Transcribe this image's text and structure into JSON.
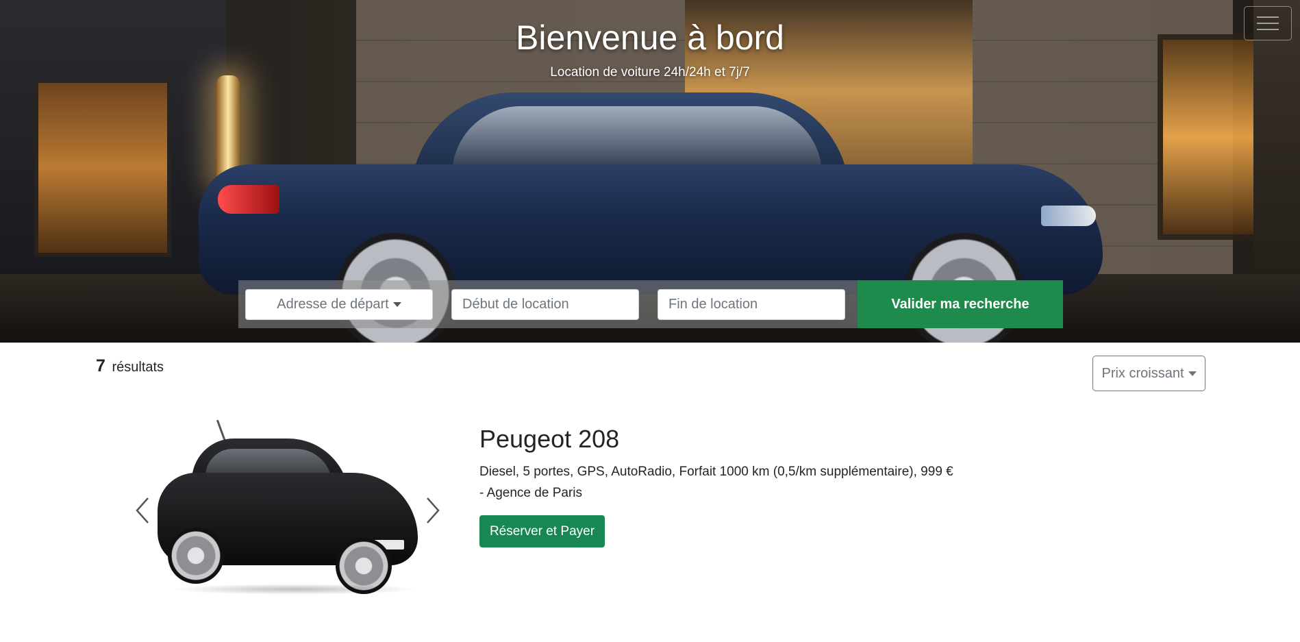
{
  "hero": {
    "title": "Bienvenue à bord",
    "subtitle": "Location de voiture 24h/24h et 7j/7"
  },
  "navbar": {
    "menu_icon": "hamburger-icon"
  },
  "search": {
    "start_address_label": "Adresse de départ",
    "start_date_placeholder": "Début de location",
    "end_date_placeholder": "Fin de location",
    "submit_label": "Valider ma recherche"
  },
  "results": {
    "count": "7",
    "count_label": "résultats",
    "sort_label": "Prix croissant"
  },
  "cars": [
    {
      "name": "Peugeot 208",
      "description": "Diesel, 5 portes, GPS, AutoRadio, Forfait 1000 km (0,5/km supplémentaire), 999 € - Agence de Paris",
      "button_label": "Réserver et Payer",
      "prev_icon": "chevron-left-icon",
      "next_icon": "chevron-right-icon"
    }
  ],
  "colors": {
    "primary_green": "#198754",
    "search_green": "#1e8a4c",
    "text": "#212529",
    "muted": "#6c757d"
  }
}
